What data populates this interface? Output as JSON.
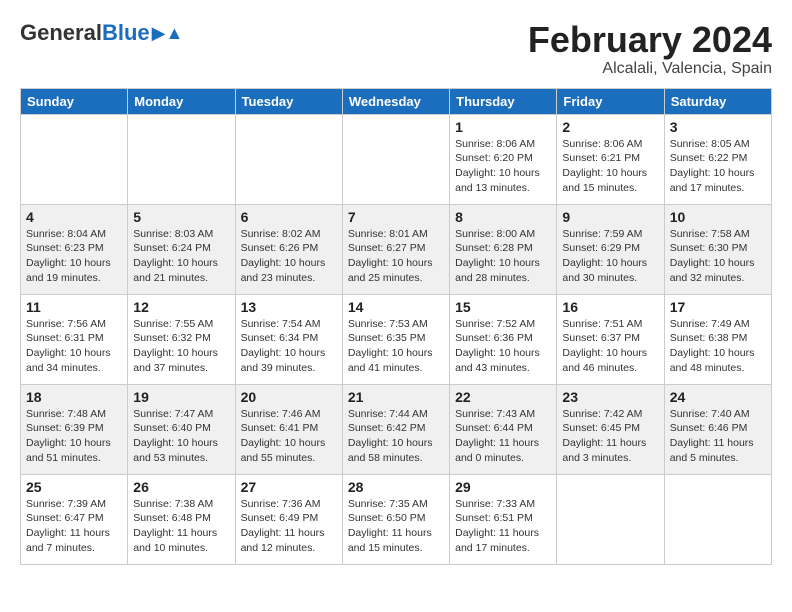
{
  "header": {
    "logo_general": "General",
    "logo_blue": "Blue",
    "month_year": "February 2024",
    "location": "Alcalali, Valencia, Spain"
  },
  "days_of_week": [
    "Sunday",
    "Monday",
    "Tuesday",
    "Wednesday",
    "Thursday",
    "Friday",
    "Saturday"
  ],
  "weeks": [
    [
      {
        "day": "",
        "info": ""
      },
      {
        "day": "",
        "info": ""
      },
      {
        "day": "",
        "info": ""
      },
      {
        "day": "",
        "info": ""
      },
      {
        "day": "1",
        "info": "Sunrise: 8:06 AM\nSunset: 6:20 PM\nDaylight: 10 hours\nand 13 minutes."
      },
      {
        "day": "2",
        "info": "Sunrise: 8:06 AM\nSunset: 6:21 PM\nDaylight: 10 hours\nand 15 minutes."
      },
      {
        "day": "3",
        "info": "Sunrise: 8:05 AM\nSunset: 6:22 PM\nDaylight: 10 hours\nand 17 minutes."
      }
    ],
    [
      {
        "day": "4",
        "info": "Sunrise: 8:04 AM\nSunset: 6:23 PM\nDaylight: 10 hours\nand 19 minutes."
      },
      {
        "day": "5",
        "info": "Sunrise: 8:03 AM\nSunset: 6:24 PM\nDaylight: 10 hours\nand 21 minutes."
      },
      {
        "day": "6",
        "info": "Sunrise: 8:02 AM\nSunset: 6:26 PM\nDaylight: 10 hours\nand 23 minutes."
      },
      {
        "day": "7",
        "info": "Sunrise: 8:01 AM\nSunset: 6:27 PM\nDaylight: 10 hours\nand 25 minutes."
      },
      {
        "day": "8",
        "info": "Sunrise: 8:00 AM\nSunset: 6:28 PM\nDaylight: 10 hours\nand 28 minutes."
      },
      {
        "day": "9",
        "info": "Sunrise: 7:59 AM\nSunset: 6:29 PM\nDaylight: 10 hours\nand 30 minutes."
      },
      {
        "day": "10",
        "info": "Sunrise: 7:58 AM\nSunset: 6:30 PM\nDaylight: 10 hours\nand 32 minutes."
      }
    ],
    [
      {
        "day": "11",
        "info": "Sunrise: 7:56 AM\nSunset: 6:31 PM\nDaylight: 10 hours\nand 34 minutes."
      },
      {
        "day": "12",
        "info": "Sunrise: 7:55 AM\nSunset: 6:32 PM\nDaylight: 10 hours\nand 37 minutes."
      },
      {
        "day": "13",
        "info": "Sunrise: 7:54 AM\nSunset: 6:34 PM\nDaylight: 10 hours\nand 39 minutes."
      },
      {
        "day": "14",
        "info": "Sunrise: 7:53 AM\nSunset: 6:35 PM\nDaylight: 10 hours\nand 41 minutes."
      },
      {
        "day": "15",
        "info": "Sunrise: 7:52 AM\nSunset: 6:36 PM\nDaylight: 10 hours\nand 43 minutes."
      },
      {
        "day": "16",
        "info": "Sunrise: 7:51 AM\nSunset: 6:37 PM\nDaylight: 10 hours\nand 46 minutes."
      },
      {
        "day": "17",
        "info": "Sunrise: 7:49 AM\nSunset: 6:38 PM\nDaylight: 10 hours\nand 48 minutes."
      }
    ],
    [
      {
        "day": "18",
        "info": "Sunrise: 7:48 AM\nSunset: 6:39 PM\nDaylight: 10 hours\nand 51 minutes."
      },
      {
        "day": "19",
        "info": "Sunrise: 7:47 AM\nSunset: 6:40 PM\nDaylight: 10 hours\nand 53 minutes."
      },
      {
        "day": "20",
        "info": "Sunrise: 7:46 AM\nSunset: 6:41 PM\nDaylight: 10 hours\nand 55 minutes."
      },
      {
        "day": "21",
        "info": "Sunrise: 7:44 AM\nSunset: 6:42 PM\nDaylight: 10 hours\nand 58 minutes."
      },
      {
        "day": "22",
        "info": "Sunrise: 7:43 AM\nSunset: 6:44 PM\nDaylight: 11 hours\nand 0 minutes."
      },
      {
        "day": "23",
        "info": "Sunrise: 7:42 AM\nSunset: 6:45 PM\nDaylight: 11 hours\nand 3 minutes."
      },
      {
        "day": "24",
        "info": "Sunrise: 7:40 AM\nSunset: 6:46 PM\nDaylight: 11 hours\nand 5 minutes."
      }
    ],
    [
      {
        "day": "25",
        "info": "Sunrise: 7:39 AM\nSunset: 6:47 PM\nDaylight: 11 hours\nand 7 minutes."
      },
      {
        "day": "26",
        "info": "Sunrise: 7:38 AM\nSunset: 6:48 PM\nDaylight: 11 hours\nand 10 minutes."
      },
      {
        "day": "27",
        "info": "Sunrise: 7:36 AM\nSunset: 6:49 PM\nDaylight: 11 hours\nand 12 minutes."
      },
      {
        "day": "28",
        "info": "Sunrise: 7:35 AM\nSunset: 6:50 PM\nDaylight: 11 hours\nand 15 minutes."
      },
      {
        "day": "29",
        "info": "Sunrise: 7:33 AM\nSunset: 6:51 PM\nDaylight: 11 hours\nand 17 minutes."
      },
      {
        "day": "",
        "info": ""
      },
      {
        "day": "",
        "info": ""
      }
    ]
  ]
}
